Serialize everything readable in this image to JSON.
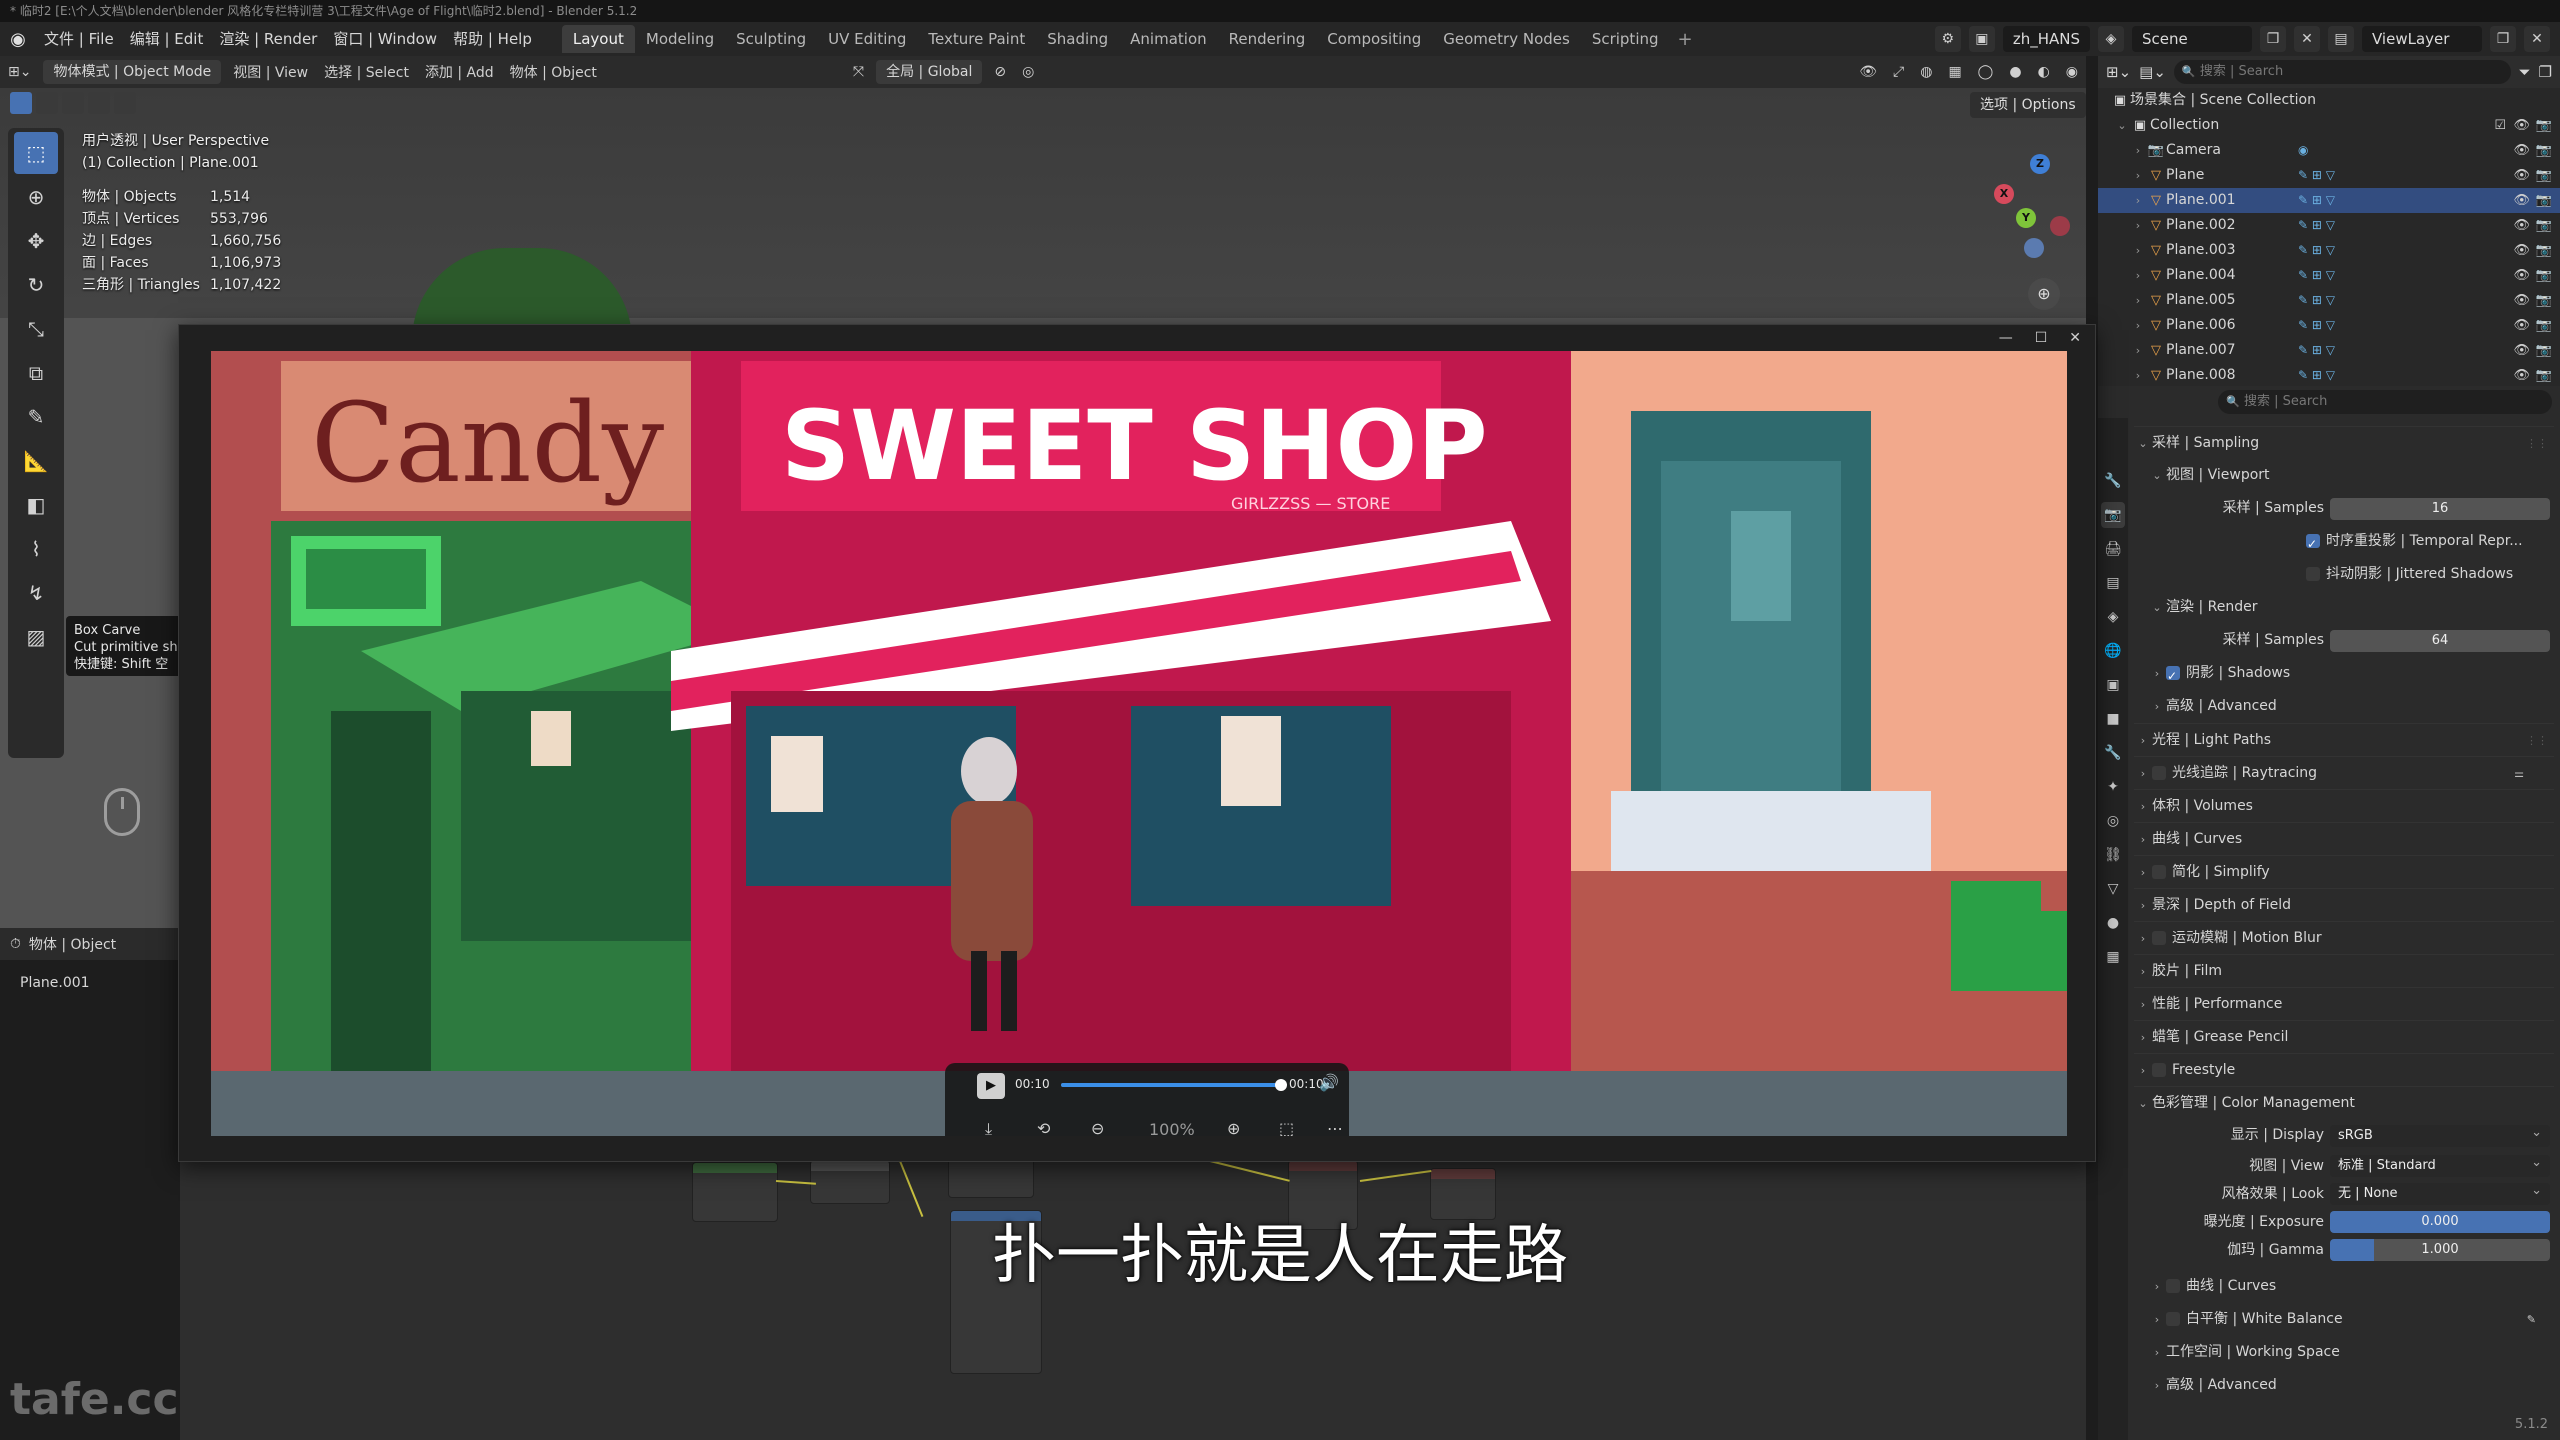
{
  "window": {
    "title": "* 临时2 [E:\\个人文档\\blender\\blender 风格化专栏特训营 3\\工程文件\\Age of Flight\\临时2.blend] - Blender 5.1.2"
  },
  "menubar": {
    "items": [
      "文件 | File",
      "编辑 | Edit",
      "渲染 | Render",
      "窗口 | Window",
      "帮助 | Help"
    ],
    "workspaces": [
      "Layout",
      "Modeling",
      "Sculpting",
      "UV Editing",
      "Texture Paint",
      "Shading",
      "Animation",
      "Rendering",
      "Compositing",
      "Geometry Nodes",
      "Scripting"
    ],
    "active_workspace": "Layout",
    "language": "zh_HANS",
    "scene": "Scene",
    "view_layer": "ViewLayer"
  },
  "viewport_header": {
    "mode": "物体模式 | Object Mode",
    "menus": [
      "视图 | View",
      "选择 | Select",
      "添加 | Add",
      "物体 | Object"
    ],
    "transform_space": "全局 | Global",
    "options": "选项 | Options"
  },
  "viewport": {
    "perspective": "用户透视 | User Perspective",
    "collection": "(1) Collection | Plane.001",
    "stats": [
      {
        "label": "物体 | Objects",
        "value": "1,514"
      },
      {
        "label": "顶点 | Vertices",
        "value": "553,796"
      },
      {
        "label": "边 | Edges",
        "value": "1,660,756"
      },
      {
        "label": "面 | Faces",
        "value": "1,106,973"
      },
      {
        "label": "三角形 | Triangles",
        "value": "1,107,422"
      }
    ],
    "tooltip": {
      "title": "Box Carve",
      "desc": "Cut primitive sh",
      "shortcut": "快捷键: Shift 空"
    },
    "gizmo_labels": {
      "x": "X",
      "y": "Y",
      "z": "Z"
    }
  },
  "bottom_left": {
    "header": "物体 | Object",
    "object": "Plane.001"
  },
  "outliner": {
    "search_placeholder": "搜索 | Search",
    "scene_collection": "场景集合 | Scene Collection",
    "collection": "Collection",
    "items": [
      "Camera",
      "Plane",
      "Plane.001",
      "Plane.002",
      "Plane.003",
      "Plane.004",
      "Plane.005",
      "Plane.006",
      "Plane.007",
      "Plane.008"
    ],
    "selected": "Plane.001"
  },
  "properties": {
    "search_placeholder": "搜索 | Search",
    "rows": {
      "sampling": "采样 | Sampling",
      "viewport": "视图 | Viewport",
      "samples_label": "采样 | Samples",
      "viewport_samples": "16",
      "temporal": "时序重投影 | Temporal Repr...",
      "jittered": "抖动阴影 | Jittered Shadows",
      "render": "渲染 | Render",
      "render_samples": "64",
      "shadows": "阴影 | Shadows",
      "advanced": "高级 | Advanced",
      "light_paths": "光程 | Light Paths",
      "raytracing": "光线追踪 | Raytracing",
      "volumes": "体积 | Volumes",
      "curves": "曲线 | Curves",
      "simplify": "简化 | Simplify",
      "dof": "景深 | Depth of Field",
      "motion_blur": "运动模糊 | Motion Blur",
      "film": "胶片 | Film",
      "performance": "性能 | Performance",
      "grease_pencil": "蜡笔 | Grease Pencil",
      "freestyle": "Freestyle",
      "color_management": "色彩管理 | Color Management",
      "display_label": "显示 | Display",
      "display_value": "sRGB",
      "view_label": "视图 | View",
      "view_value": "标准 | Standard",
      "look_label": "风格效果 | Look",
      "look_value": "无 | None",
      "exposure_label": "曝光度 | Exposure",
      "exposure_value": "0.000",
      "gamma_label": "伽玛 | Gamma",
      "gamma_value": "1.000",
      "cm_curves": "曲线 | Curves",
      "white_balance": "白平衡 | White Balance",
      "working_space": "工作空间 | Working Space",
      "cm_advanced": "高级 | Advanced"
    },
    "version": "5.1.2"
  },
  "player": {
    "current_time": "00:10",
    "total_time": "00:10",
    "progress": 1.0,
    "zoom": "100%",
    "sign_candy": "Candy",
    "sign_shop": "SWEET SHOP",
    "sign_store": "GIRLZZSS — STORE"
  },
  "subtitle": "扑一扑就是人在走路",
  "watermark": "tafe.cc"
}
